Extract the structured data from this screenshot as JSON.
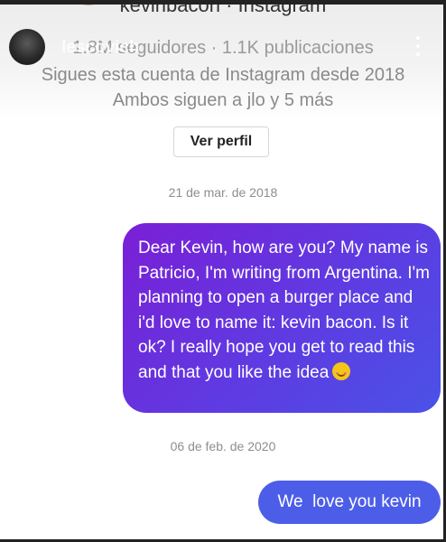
{
  "header": {
    "account_title": "kevinbacon · Instagram",
    "username": "lescovich",
    "followers_line": "1.8M seguidores · 1.1K publicaciones",
    "since_line": "Sigues esta cuenta de Instagram desde 2018",
    "mutual_line": "Ambos siguen a jlo y 5 más"
  },
  "profile": {
    "view_button_label": "Ver perfil"
  },
  "messages": [
    {
      "date": "21 de mar. de 2018",
      "text": "Dear Kevin, how are you? My name is Patricio, I'm writing from Argentina. I'm planning to open a burger place and i'd love to name it: kevin bacon. Is it ok? I really hope you get to read this and that you like the idea",
      "emoji": "smiling-face-icon"
    },
    {
      "date": "06 de feb. de 2020",
      "text": "We  love you kevin"
    }
  ],
  "colors": {
    "bubble_gradient_start": "#7a1fd6",
    "bubble_gradient_end": "#4a52e6",
    "bubble_solid": "#4c5ee8"
  }
}
